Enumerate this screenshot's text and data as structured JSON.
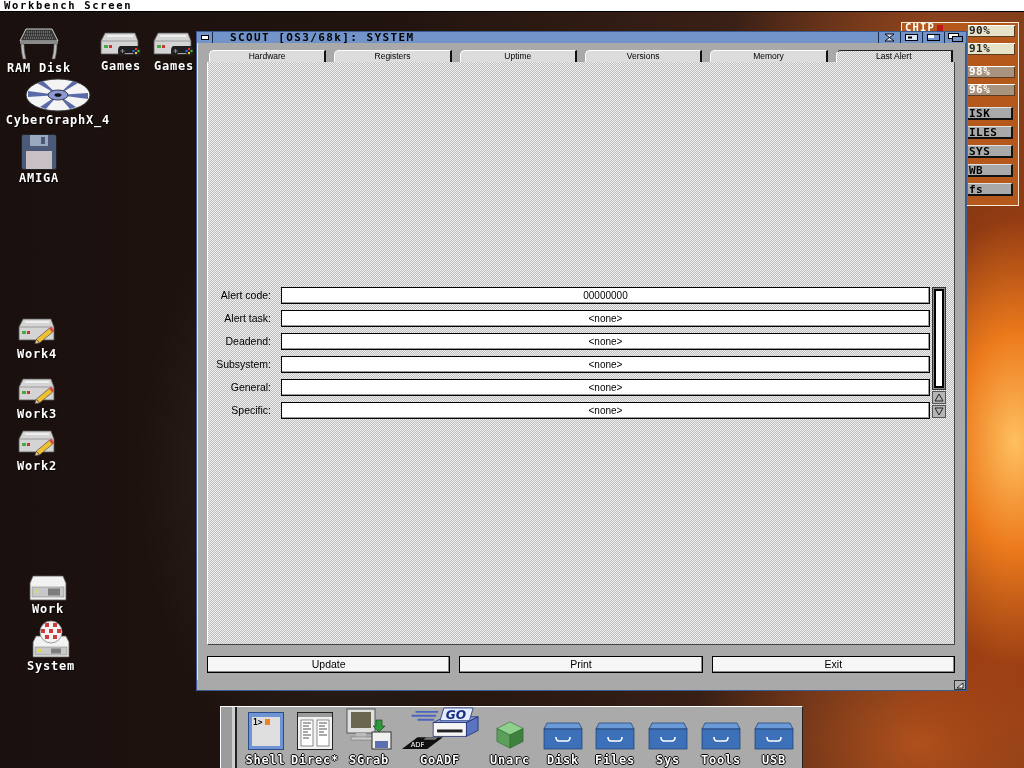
{
  "screen": {
    "title": "Workbench Screen"
  },
  "desktop_icons": [
    {
      "label": "RAM Disk",
      "kind": "ram"
    },
    {
      "label": "Games",
      "kind": "gamepad-drive"
    },
    {
      "label": "Games",
      "kind": "gamepad-drive"
    },
    {
      "label": "CyberGraphX_4",
      "kind": "disc"
    },
    {
      "label": "AMIGA",
      "kind": "floppy"
    },
    {
      "label": "Work4",
      "kind": "pencil-drive"
    },
    {
      "label": "Work3",
      "kind": "pencil-drive"
    },
    {
      "label": "Work2",
      "kind": "pencil-drive"
    },
    {
      "label": "Work",
      "kind": "drive"
    },
    {
      "label": "System",
      "kind": "ball-drive"
    }
  ],
  "monitor": {
    "label": "CHIP",
    "gauges": [
      {
        "reading": "90%",
        "color": "#e6e2c8"
      },
      {
        "reading": "91%",
        "color": "#e6e2c8"
      },
      {
        "reading": "98%",
        "color": "#a8937f"
      },
      {
        "reading": "96%",
        "color": "#a8937f"
      }
    ],
    "buttons": [
      "ISK",
      "ILES",
      "SYS",
      "WB",
      "fs"
    ]
  },
  "window": {
    "title": "SCOUT [OS3/68k]: SYSTEM",
    "tabs": [
      {
        "label": "Hardware",
        "selected": false
      },
      {
        "label": "Registers",
        "selected": false
      },
      {
        "label": "Uptime",
        "selected": false
      },
      {
        "label": "Versions",
        "selected": false
      },
      {
        "label": "Memory",
        "selected": false
      },
      {
        "label": "Last Alert",
        "selected": true
      }
    ],
    "fields": [
      {
        "label": "Alert code:",
        "value": "00000000"
      },
      {
        "label": "Alert task:",
        "value": "<none>"
      },
      {
        "label": "Deadend:",
        "value": "<none>"
      },
      {
        "label": "Subsystem:",
        "value": "<none>"
      },
      {
        "label": "General:",
        "value": "<none>"
      },
      {
        "label": "Specific:",
        "value": "<none>"
      }
    ],
    "buttons": [
      "Update",
      "Print",
      "Exit"
    ]
  },
  "dock": {
    "items": [
      {
        "label": "Shell",
        "kind": "shell",
        "icon_text": [
          "1>"
        ]
      },
      {
        "label": "Direc*",
        "kind": "directory"
      },
      {
        "label": "SGrab",
        "kind": "grabber"
      },
      {
        "label": "GoADF",
        "kind": "goadf",
        "icon_text": [
          "GO",
          "ADF"
        ]
      },
      {
        "label": "Unarc",
        "kind": "cube"
      },
      {
        "label": "Disk",
        "kind": "drawer"
      },
      {
        "label": "Files",
        "kind": "drawer"
      },
      {
        "label": "Sys",
        "kind": "drawer"
      },
      {
        "label": "Tools",
        "kind": "drawer"
      },
      {
        "label": "USB",
        "kind": "drawer"
      }
    ]
  }
}
